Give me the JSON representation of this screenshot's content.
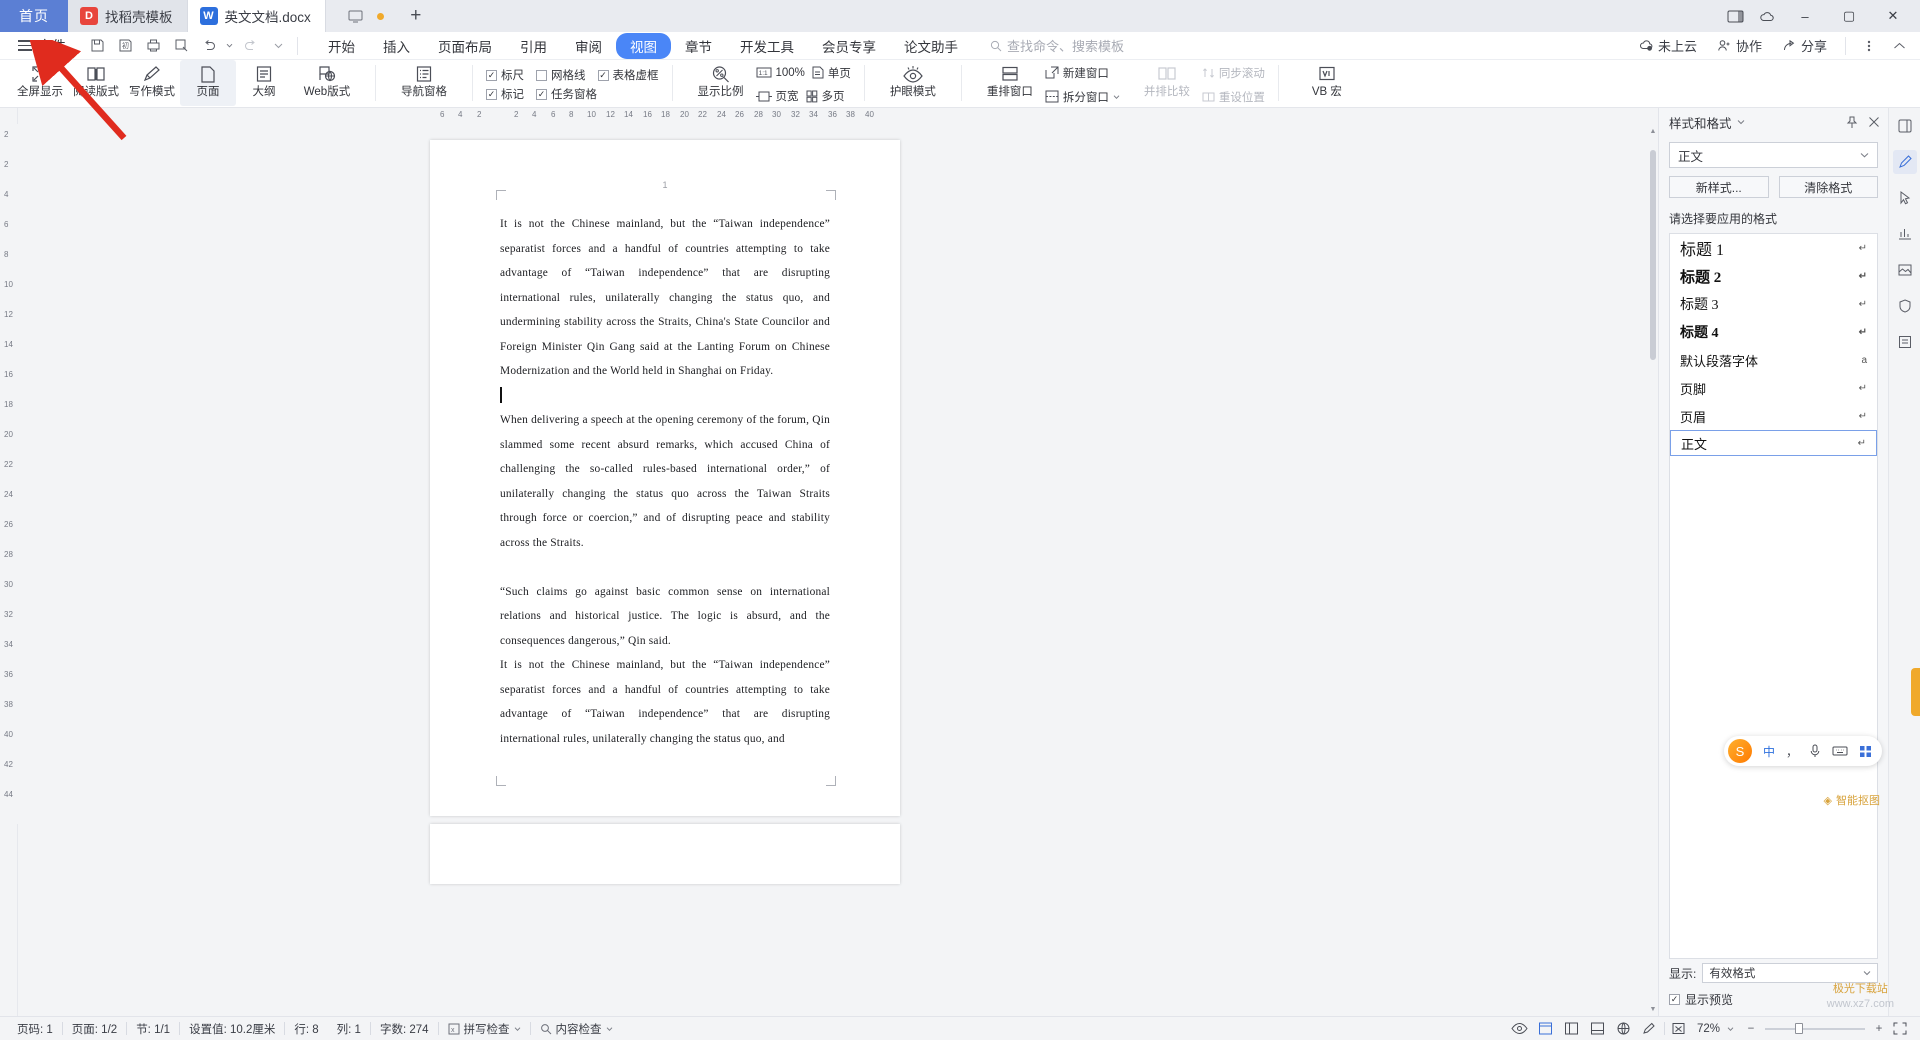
{
  "tabstrip": {
    "home_label": "首页",
    "tabs": [
      {
        "label": "找稻壳模板",
        "icon": "docer-icon",
        "active": false
      },
      {
        "label": "英文文档.docx",
        "icon": "wps-writer-icon",
        "active": true
      }
    ],
    "new_tab_label": "+",
    "monitor_icon": "monitor-icon",
    "unsaved_dot": "unsaved-indicator",
    "right_icons": [
      "panel-layout-icon",
      "cloud-sync-icon"
    ],
    "window_buttons": {
      "minimize": "–",
      "maximize": "▢",
      "close": "✕"
    }
  },
  "menubar": {
    "file_label": "文件",
    "quick_access": [
      "save-icon",
      "save-as-icon",
      "print-icon",
      "print-preview-icon",
      "undo-icon",
      "undo-dropdown",
      "redo-icon",
      "qat-more-icon"
    ],
    "tabs": [
      {
        "label": "开始",
        "active": false
      },
      {
        "label": "插入",
        "active": false
      },
      {
        "label": "页面布局",
        "active": false
      },
      {
        "label": "引用",
        "active": false
      },
      {
        "label": "审阅",
        "active": false
      },
      {
        "label": "视图",
        "active": true
      },
      {
        "label": "章节",
        "active": false
      },
      {
        "label": "开发工具",
        "active": false
      },
      {
        "label": "会员专享",
        "active": false
      },
      {
        "label": "论文助手",
        "active": false
      }
    ],
    "search_placeholder": "查找命令、搜索模板",
    "right_items": [
      {
        "label": "未上云",
        "icon": "cloud-off-icon"
      },
      {
        "label": "协作",
        "icon": "collaborate-icon"
      },
      {
        "label": "分享",
        "icon": "share-icon"
      }
    ],
    "more_icon": "more-vertical-icon",
    "collapse_icon": "chevron-up-icon"
  },
  "ribbon": {
    "items": [
      {
        "label": "全屏显示",
        "icon": "fullscreen-icon",
        "active": false
      },
      {
        "label": "阅读版式",
        "icon": "book-icon",
        "active": false,
        "dropdown": true
      },
      {
        "label": "写作模式",
        "icon": "pencil-icon",
        "active": false,
        "dropdown": true
      },
      {
        "label": "页面",
        "icon": "page-icon",
        "active": true
      },
      {
        "label": "大纲",
        "icon": "outline-icon",
        "active": false
      },
      {
        "label": "Web版式",
        "icon": "web-layout-icon",
        "active": false
      }
    ],
    "nav_pane": {
      "label": "导航窗格",
      "icon": "nav-pane-icon",
      "dropdown": true
    },
    "checkboxes": [
      {
        "label": "标尺",
        "checked": true
      },
      {
        "label": "网格线",
        "checked": false
      },
      {
        "label": "表格虚框",
        "checked": true
      },
      {
        "label": "标记",
        "checked": true
      },
      {
        "label": "任务窗格",
        "checked": true
      }
    ],
    "zoom_group": {
      "zoom_icon_label": "显示比例",
      "zoom_icon": "zoom-percent-icon",
      "ratio_100": "100%",
      "ratio_100_icon": "one-to-one-icon",
      "page_width": "页宽",
      "page_width_icon": "page-width-icon",
      "single_page": "单页",
      "single_page_icon": "single-page-icon",
      "multi_page": "多页",
      "multi_page_icon": "multi-page-icon"
    },
    "eye_protect": {
      "label": "护眼模式",
      "icon": "eye-icon"
    },
    "windows": {
      "rearrange": "重排窗口",
      "rearrange_icon": "rearrange-icon",
      "new_window": "新建窗口",
      "new_window_icon": "new-window-icon",
      "split_window": "拆分窗口",
      "split_window_icon": "split-window-icon",
      "side_by_side": "并排比较",
      "side_by_side_icon": "side-by-side-icon",
      "sync_scroll": "同步滚动",
      "sync_scroll_icon": "sync-scroll-icon",
      "reset_position": "重设位置",
      "reset_position_icon": "reset-position-icon"
    },
    "vb_macro": {
      "label": "VB 宏",
      "icon": "macro-icon"
    }
  },
  "ruler": {
    "left_numbers": [
      "6",
      "4",
      "2"
    ],
    "numbers": [
      "2",
      "4",
      "6",
      "8",
      "10",
      "12",
      "14",
      "16",
      "18",
      "20",
      "22",
      "24",
      "26",
      "28",
      "30",
      "32",
      "34",
      "36",
      "38",
      "40"
    ],
    "vertical_numbers": [
      "2",
      "2",
      "4",
      "6",
      "8",
      "10",
      "12",
      "14",
      "16",
      "18",
      "20",
      "22",
      "24",
      "26",
      "28",
      "30",
      "32",
      "34",
      "36",
      "38",
      "40",
      "42",
      "44"
    ]
  },
  "document": {
    "page_mark": "1",
    "paragraphs": [
      "It is not the Chinese mainland, but the “Taiwan independence” separatist forces and a handful of countries attempting to take advantage of “Taiwan independence” that are disrupting international rules, unilaterally changing the status quo, and undermining stability across the Straits, China's State Councilor and Foreign Minister Qin Gang said at the Lanting Forum on Chinese Modernization and the World held in Shanghai on Friday.",
      "",
      "When delivering a speech at the opening ceremony of the forum, Qin slammed some recent absurd remarks, which accused China of challenging the so-called rules-based international order,” of unilaterally changing the status quo across the Taiwan Straits through force or coercion,” and of disrupting peace and stability across the Straits.",
      "",
      "“Such claims go against basic common sense on international relations and historical justice. The logic is absurd, and the consequences dangerous,” Qin said.",
      "It is not the Chinese mainland, but the “Taiwan independence” separatist forces and a handful of countries attempting to take advantage of “Taiwan independence” that are disrupting international rules, unilaterally changing the status quo, and"
    ]
  },
  "pane": {
    "title": "样式和格式",
    "title_dropdown_icon": "chevron-down-icon",
    "pin_icon": "pin-icon",
    "close_icon": "close-icon",
    "current_style": "正文",
    "select_arrow_icon": "chevron-down-icon",
    "new_style_button": "新样式...",
    "clear_format_button": "清除格式",
    "hint": "请选择要应用的格式",
    "styles": [
      {
        "label": "标题 1",
        "mark": "↵",
        "kind": "h1",
        "selected": false
      },
      {
        "label": "标题 2",
        "mark": "↵",
        "kind": "h2",
        "selected": false
      },
      {
        "label": "标题 3",
        "mark": "↵",
        "kind": "h3",
        "selected": false
      },
      {
        "label": "标题 4",
        "mark": "↵",
        "kind": "h4",
        "selected": false
      },
      {
        "label": "默认段落字体",
        "mark": "a",
        "kind": "plain",
        "selected": false
      },
      {
        "label": "页脚",
        "mark": "↵",
        "kind": "plain",
        "selected": false
      },
      {
        "label": "页眉",
        "mark": "↵",
        "kind": "plain",
        "selected": false
      },
      {
        "label": "正文",
        "mark": "↵",
        "kind": "plain",
        "selected": true
      }
    ],
    "show_label": "显示:",
    "show_value": "有效格式",
    "preview_label": "显示预览",
    "preview_checked": true
  },
  "rail": {
    "buttons": [
      "rail-panel-icon",
      "rail-brush-icon",
      "rail-cursor-icon",
      "rail-chart-icon",
      "rail-picture-icon",
      "rail-shield-icon",
      "rail-image-icon"
    ]
  },
  "ime": {
    "logo": "sogou-ime-icon",
    "mode": "中",
    "punct_icon": "punctuation-icon",
    "mic_icon": "microphone-icon",
    "keyboard_icon": "keyboard-icon",
    "grid_icon": "grid-icon"
  },
  "watermark": {
    "line1": "极光下载站",
    "line2": "www.xz7.com"
  },
  "smart_tag": {
    "label": "智能抠图",
    "icon": "sparkle-icon"
  },
  "status": {
    "items": [
      "页码: 1",
      "页面: 1/2",
      "节: 1/1",
      "设置值: 10.2厘米",
      "行: 8",
      "列: 1",
      "字数: 274"
    ],
    "spell_check": "拼写检查",
    "spell_check_icon": "spell-check-icon",
    "content_check": "内容检查",
    "content_check_icon": "content-check-icon",
    "view_icons": [
      "eye-protect-icon",
      "page-view-icon",
      "outline-view-icon",
      "reading-view-icon",
      "web-view-icon",
      "pen-icon"
    ],
    "fit_icon": "fit-page-icon",
    "zoom_label": "72%",
    "zoom_dropdown_icon": "chevron-down-icon",
    "zoom_minus": "−",
    "zoom_plus": "+",
    "zoom_percent": 72,
    "fullscreen_icon": "fullscreen-toggle-icon"
  },
  "annotation": {
    "arrow_color": "#e02b1e",
    "points_to": "file-menu"
  }
}
